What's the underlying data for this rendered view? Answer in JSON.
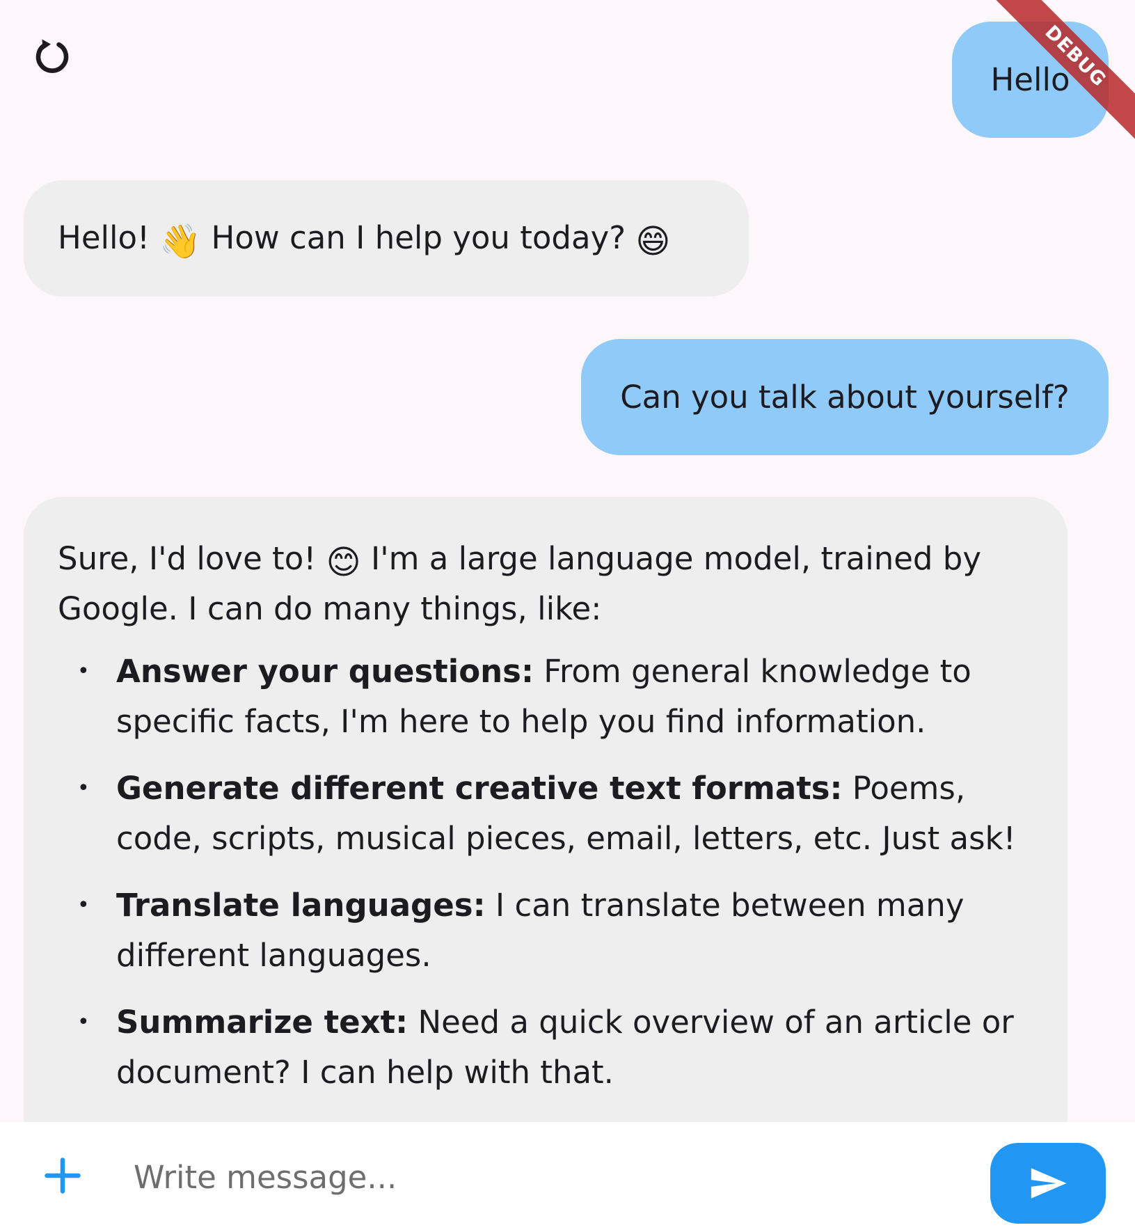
{
  "header": {
    "refresh_icon": "refresh-icon",
    "debug_banner": "DEBUG"
  },
  "messages": [
    {
      "role": "user",
      "text": "Hello"
    },
    {
      "role": "bot",
      "text_before": "Hello!",
      "emoji1": "👋",
      "text_mid": "How can I help you today?",
      "emoji2": "😄"
    },
    {
      "role": "user",
      "text": "Can you talk about yourself?"
    },
    {
      "role": "bot",
      "intro_before": "Sure, I'd love to!",
      "intro_emoji": "😊",
      "intro_after": "I'm a large language model, trained by Google. I can do many things, like:",
      "bullet": "•",
      "items": [
        {
          "title": "Answer your questions:",
          "text": "From general knowledge to specific facts, I'm here to help you find information."
        },
        {
          "title": "Generate different creative text formats:",
          "text": "Poems, code, scripts, musical pieces, email, letters, etc.  Just ask!"
        },
        {
          "title": "Translate languages:",
          "text": "I can translate between many different languages."
        },
        {
          "title": "Summarize text:",
          "text": "Need a quick overview of an article or document? I can help with that."
        }
      ]
    }
  ],
  "composer": {
    "add_icon": "plus-icon",
    "placeholder": "Write message...",
    "value": "",
    "send_icon": "send-icon"
  },
  "colors": {
    "background": "#fdf6fb",
    "user_bubble": "#90caf9",
    "bot_bubble": "#eeeeee",
    "accent": "#2196f3",
    "debug_ribbon": "#b72828"
  }
}
